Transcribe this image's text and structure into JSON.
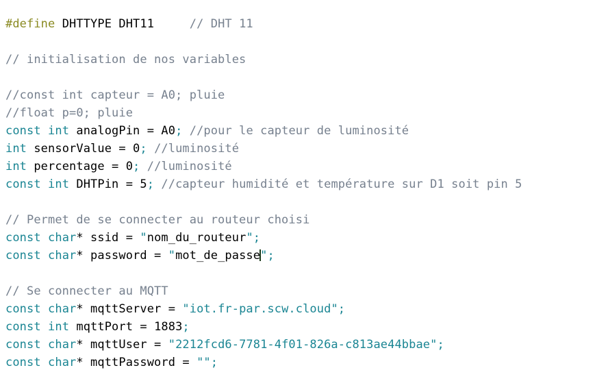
{
  "editor": {
    "background_color": "#ffffff",
    "font_size_px": 17,
    "line_height_px": 26,
    "language": "C++ / Arduino",
    "caret": {
      "visible": true,
      "line_index": 12,
      "after_text": "mot_de_passe",
      "color": "#1c3a1c"
    }
  },
  "theme": {
    "directive_color": "#8a8a22",
    "keyword_color": "#1a8593",
    "comment_color": "#76808e",
    "plain_color": "#000000",
    "punctuation_color": "#1a8593",
    "string_color": "#1a8593",
    "string_plain_color": "#000000"
  },
  "code": {
    "lines": [
      {
        "index": 0,
        "blank": false,
        "text": "#define DHTTYPE DHT11     // DHT 11",
        "tokens": [
          {
            "t": "#define",
            "c": "directive"
          },
          {
            "t": " DHTTYPE DHT11     ",
            "c": "plain"
          },
          {
            "t": "// DHT 11",
            "c": "comment"
          }
        ]
      },
      {
        "index": 1,
        "blank": true,
        "text": "",
        "tokens": []
      },
      {
        "index": 2,
        "blank": false,
        "text": "// initialisation de nos variables",
        "tokens": [
          {
            "t": "// initialisation de nos variables",
            "c": "comment"
          }
        ]
      },
      {
        "index": 3,
        "blank": true,
        "text": "",
        "tokens": []
      },
      {
        "index": 4,
        "blank": false,
        "text": "//const int capteur = A0; pluie",
        "tokens": [
          {
            "t": "//const int capteur = A0; pluie",
            "c": "comment"
          }
        ]
      },
      {
        "index": 5,
        "blank": false,
        "text": "//float p=0; pluie",
        "tokens": [
          {
            "t": "//float p=0; pluie",
            "c": "comment"
          }
        ]
      },
      {
        "index": 6,
        "blank": false,
        "text": "const int analogPin = A0; //pour le capteur de luminosité",
        "tokens": [
          {
            "t": "const",
            "c": "keyword"
          },
          {
            "t": " ",
            "c": "plain"
          },
          {
            "t": "int",
            "c": "keyword"
          },
          {
            "t": " analogPin = A0",
            "c": "plain"
          },
          {
            "t": ";",
            "c": "punct"
          },
          {
            "t": " ",
            "c": "plain"
          },
          {
            "t": "//pour le capteur de luminosité",
            "c": "comment"
          }
        ]
      },
      {
        "index": 7,
        "blank": false,
        "text": "int sensorValue = 0; //luminosité",
        "tokens": [
          {
            "t": "int",
            "c": "keyword"
          },
          {
            "t": " sensorValue = 0",
            "c": "plain"
          },
          {
            "t": ";",
            "c": "punct"
          },
          {
            "t": " ",
            "c": "plain"
          },
          {
            "t": "//luminosité",
            "c": "comment"
          }
        ]
      },
      {
        "index": 8,
        "blank": false,
        "text": "int percentage = 0; //luminosité",
        "tokens": [
          {
            "t": "int",
            "c": "keyword"
          },
          {
            "t": " percentage = 0",
            "c": "plain"
          },
          {
            "t": ";",
            "c": "punct"
          },
          {
            "t": " ",
            "c": "plain"
          },
          {
            "t": "//luminosité",
            "c": "comment"
          }
        ]
      },
      {
        "index": 9,
        "blank": false,
        "text": "const int DHTPin = 5; //capteur humidité et température sur D1 soit pin 5",
        "tokens": [
          {
            "t": "const",
            "c": "keyword"
          },
          {
            "t": " ",
            "c": "plain"
          },
          {
            "t": "int",
            "c": "keyword"
          },
          {
            "t": " DHTPin = 5",
            "c": "plain"
          },
          {
            "t": ";",
            "c": "punct"
          },
          {
            "t": " ",
            "c": "plain"
          },
          {
            "t": "//capteur humidité et température sur D1 soit pin 5",
            "c": "comment"
          }
        ]
      },
      {
        "index": 10,
        "blank": true,
        "text": "",
        "tokens": []
      },
      {
        "index": 11,
        "blank": false,
        "text": "// Permet de se connecter au routeur choisi",
        "tokens": [
          {
            "t": "// Permet de se connecter au routeur choisi",
            "c": "comment"
          }
        ]
      },
      {
        "index": 12,
        "blank": false,
        "text": "const char* ssid = \"nom_du_routeur\";",
        "tokens": [
          {
            "t": "const",
            "c": "keyword"
          },
          {
            "t": " ",
            "c": "plain"
          },
          {
            "t": "char",
            "c": "keyword"
          },
          {
            "t": "* ssid = ",
            "c": "plain"
          },
          {
            "t": "\"",
            "c": "punct"
          },
          {
            "t": "nom_du_routeur",
            "c": "strplain"
          },
          {
            "t": "\";",
            "c": "punct"
          }
        ]
      },
      {
        "index": 13,
        "blank": false,
        "text": "const char* password = \"mot_de_passe\";",
        "tokens": [
          {
            "t": "const",
            "c": "keyword"
          },
          {
            "t": " ",
            "c": "plain"
          },
          {
            "t": "char",
            "c": "keyword"
          },
          {
            "t": "* password = ",
            "c": "plain"
          },
          {
            "t": "\"",
            "c": "punct"
          },
          {
            "t": "mot_de_passe",
            "c": "strplain"
          },
          {
            "t": "CARET",
            "c": "caret"
          },
          {
            "t": "\";",
            "c": "punct"
          }
        ]
      },
      {
        "index": 14,
        "blank": true,
        "text": "",
        "tokens": []
      },
      {
        "index": 15,
        "blank": false,
        "text": "// Se connecter au MQTT",
        "tokens": [
          {
            "t": "// Se connecter au MQTT",
            "c": "comment"
          }
        ]
      },
      {
        "index": 16,
        "blank": false,
        "text": "const char* mqttServer = \"iot.fr-par.scw.cloud\";",
        "tokens": [
          {
            "t": "const",
            "c": "keyword"
          },
          {
            "t": " ",
            "c": "plain"
          },
          {
            "t": "char",
            "c": "keyword"
          },
          {
            "t": "* mqttServer = ",
            "c": "plain"
          },
          {
            "t": "\"iot.fr-par.scw.cloud\";",
            "c": "string"
          }
        ]
      },
      {
        "index": 17,
        "blank": false,
        "text": "const int mqttPort = 1883;",
        "tokens": [
          {
            "t": "const",
            "c": "keyword"
          },
          {
            "t": " ",
            "c": "plain"
          },
          {
            "t": "int",
            "c": "keyword"
          },
          {
            "t": " mqttPort = 1883",
            "c": "plain"
          },
          {
            "t": ";",
            "c": "punct"
          }
        ]
      },
      {
        "index": 18,
        "blank": false,
        "text": "const char* mqttUser = \"2212fcd6-7781-4f01-826a-c813ae44bbae\";",
        "tokens": [
          {
            "t": "const",
            "c": "keyword"
          },
          {
            "t": " ",
            "c": "plain"
          },
          {
            "t": "char",
            "c": "keyword"
          },
          {
            "t": "* mqttUser = ",
            "c": "plain"
          },
          {
            "t": "\"2212fcd6-7781-4f01-826a-c813ae44bbae\";",
            "c": "string"
          }
        ]
      },
      {
        "index": 19,
        "blank": false,
        "text": "const char* mqttPassword = \"\";",
        "tokens": [
          {
            "t": "const",
            "c": "keyword"
          },
          {
            "t": " ",
            "c": "plain"
          },
          {
            "t": "char",
            "c": "keyword"
          },
          {
            "t": "* mqttPassword = ",
            "c": "plain"
          },
          {
            "t": "\"\";",
            "c": "punct"
          }
        ]
      }
    ]
  }
}
